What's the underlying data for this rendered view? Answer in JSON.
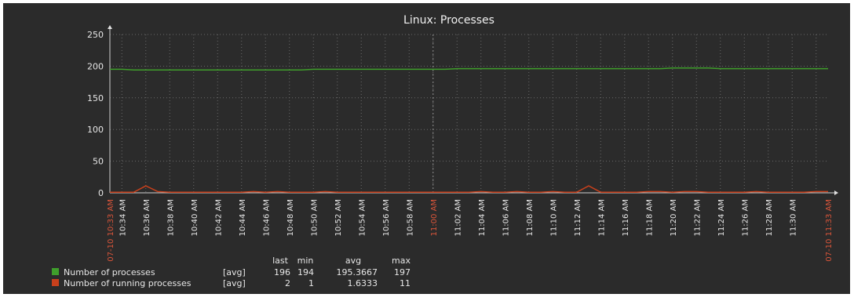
{
  "chart_data": {
    "type": "line",
    "title": "Linux: Processes",
    "ylim": [
      0,
      250
    ],
    "yticks": [
      0,
      50,
      100,
      150,
      200,
      250
    ],
    "grid": true,
    "x_start_label": "07-10 10:33 AM",
    "x_end_label": "07-10 11:33 AM",
    "x_minor_labels": [
      "10:34 AM",
      "10:36 AM",
      "10:38 AM",
      "10:40 AM",
      "10:42 AM",
      "10:44 AM",
      "10:46 AM",
      "10:48 AM",
      "10:50 AM",
      "10:52 AM",
      "10:54 AM",
      "10:56 AM",
      "10:58 AM",
      "11:00 AM",
      "11:02 AM",
      "11:04 AM",
      "11:06 AM",
      "11:08 AM",
      "11:10 AM",
      "11:12 AM",
      "11:14 AM",
      "11:16 AM",
      "11:18 AM",
      "11:20 AM",
      "11:22 AM",
      "11:24 AM",
      "11:26 AM",
      "11:28 AM",
      "11:30 AM"
    ],
    "x_major_label_index": 13,
    "x_minutes": [
      0,
      1,
      2,
      3,
      4,
      5,
      6,
      7,
      8,
      9,
      10,
      11,
      12,
      13,
      14,
      15,
      16,
      17,
      18,
      19,
      20,
      21,
      22,
      23,
      24,
      25,
      26,
      27,
      28,
      29,
      30,
      31,
      32,
      33,
      34,
      35,
      36,
      37,
      38,
      39,
      40,
      41,
      42,
      43,
      44,
      45,
      46,
      47,
      48,
      49,
      50,
      51,
      52,
      53,
      54,
      55,
      56,
      57,
      58,
      59,
      60
    ],
    "series": [
      {
        "name": "Number of processes",
        "color": "#3f9e2b",
        "func": "[avg]",
        "last": "196",
        "min": "194",
        "avg": "195.3667",
        "max": "197",
        "values": [
          195,
          195,
          194,
          194,
          194,
          194,
          194,
          194,
          194,
          194,
          194,
          194,
          194,
          194,
          194,
          194,
          194,
          195,
          195,
          195,
          195,
          195,
          195,
          195,
          195,
          195,
          195,
          195,
          195,
          196,
          196,
          196,
          196,
          196,
          196,
          196,
          196,
          196,
          196,
          196,
          196,
          196,
          196,
          196,
          196,
          196,
          196,
          197,
          197,
          197,
          197,
          196,
          196,
          196,
          196,
          196,
          196,
          196,
          196,
          196,
          196
        ]
      },
      {
        "name": "Number of running processes",
        "color": "#c8401c",
        "func": "[avg]",
        "last": "2",
        "min": "1",
        "avg": "1.6333",
        "max": "11",
        "values": [
          1,
          1,
          1,
          11,
          2,
          1,
          1,
          1,
          1,
          1,
          1,
          1,
          2,
          1,
          2,
          1,
          1,
          1,
          2,
          1,
          1,
          1,
          1,
          1,
          1,
          1,
          1,
          1,
          1,
          1,
          1,
          2,
          1,
          1,
          2,
          1,
          1,
          2,
          1,
          1,
          11,
          1,
          1,
          1,
          1,
          2,
          2,
          1,
          2,
          2,
          1,
          1,
          1,
          1,
          2,
          1,
          1,
          1,
          1,
          2,
          2
        ]
      }
    ]
  },
  "legend": {
    "header_last": "last",
    "header_min": "min",
    "header_avg": "avg",
    "header_max": "max"
  }
}
